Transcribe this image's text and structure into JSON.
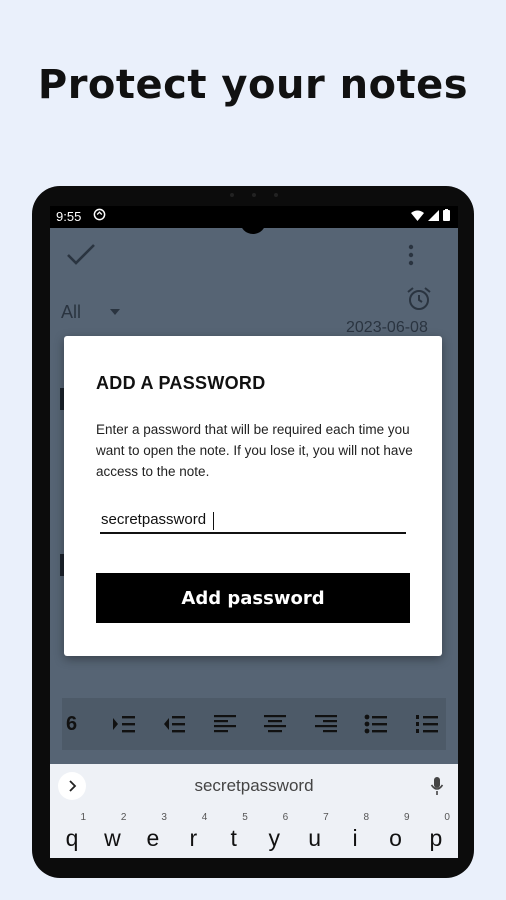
{
  "headline": "Protect your notes",
  "status_bar": {
    "time": "9:55"
  },
  "editor": {
    "filter_label": "All",
    "date": "2023-06-08",
    "format_counter": "6"
  },
  "dialog": {
    "title": "ADD A PASSWORD",
    "body": "Enter a password that will be required each time you want to open the note. If you lose it, you will not have access to the note.",
    "password_value": "secretpassword",
    "button_label": "Add password"
  },
  "keyboard": {
    "suggestion": "secretpassword",
    "keys": [
      {
        "letter": "q",
        "hint": "1"
      },
      {
        "letter": "w",
        "hint": "2"
      },
      {
        "letter": "e",
        "hint": "3"
      },
      {
        "letter": "r",
        "hint": "4"
      },
      {
        "letter": "t",
        "hint": "5"
      },
      {
        "letter": "y",
        "hint": "6"
      },
      {
        "letter": "u",
        "hint": "7"
      },
      {
        "letter": "i",
        "hint": "8"
      },
      {
        "letter": "o",
        "hint": "9"
      },
      {
        "letter": "p",
        "hint": "0"
      }
    ]
  },
  "colors": {
    "page_background": "#eaf0fb",
    "screen_dim": "#566474",
    "dialog": "#ffffff",
    "button": "#000000"
  },
  "icons": [
    "check-icon",
    "more-vert-icon",
    "alarm-icon",
    "dropdown-arrow-icon",
    "indent-icon",
    "outdent-icon",
    "align-left-icon",
    "align-center-icon",
    "align-right-icon",
    "bullet-list-icon",
    "numbered-list-icon",
    "chevron-right-icon",
    "mic-icon",
    "wifi-icon",
    "signal-icon",
    "battery-icon"
  ]
}
